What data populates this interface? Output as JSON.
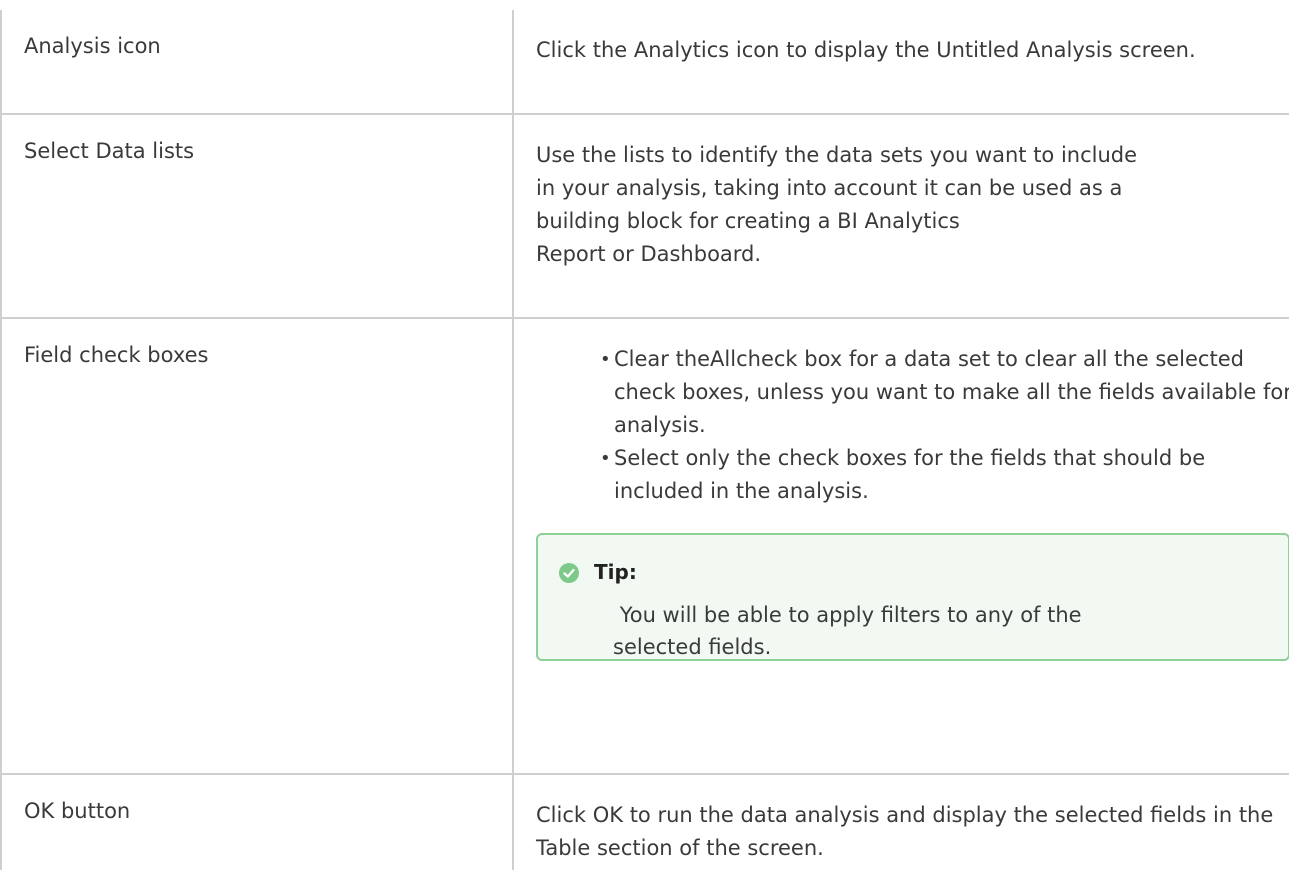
{
  "table": {
    "rows": [
      {
        "label": "Analysis icon",
        "description": "Click the Analytics icon to display the Untitled Analysis screen."
      },
      {
        "label": "Select Data lists",
        "description_lines": [
          "Use the lists to identify the data sets you want to include",
          "in your analysis, taking into account it can be used as a",
          "building block for creating a BI Analytics",
          "Report or Dashboard."
        ]
      },
      {
        "label": "Field check boxes",
        "bullets": [
          "Clear theAllcheck box for a data set to clear all the selected check boxes, unless you want to make all the fields available for analysis.",
          "Select only the check boxes for the fields that should be included in the analysis."
        ],
        "tip": {
          "title": "Tip:",
          "body": " You will be able to apply filters to any of the selected fields.",
          "icon": "check-circle-icon",
          "accent_color": "#7cc98a",
          "background_color": "#f2f9f3"
        }
      },
      {
        "label": "OK button",
        "description": "Click OK to run the data analysis and display the selected fields in the Table section of the screen."
      }
    ]
  },
  "colors": {
    "text": "#3a3a3a",
    "border": "#cfcfcf"
  }
}
